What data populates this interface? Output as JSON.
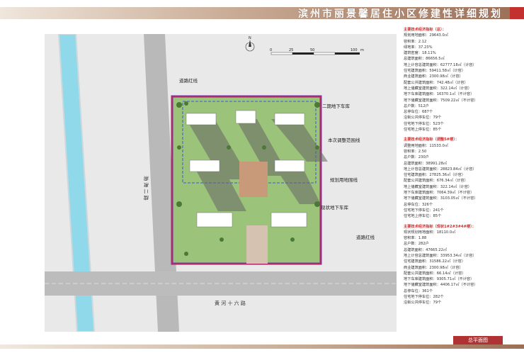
{
  "header": {
    "title": "滨州市丽景馨居住小区修建性详细规划"
  },
  "plan": {
    "road_vertical": "渤 海 二 路",
    "road_horizontal": "黄 河 十 六 路",
    "callouts": {
      "road_redline_top": "道路红线",
      "phase2_garage": "二期地下车库",
      "adjust_scope": "本次调整范围线",
      "planning_land": "规划用地围线",
      "existing_garage": "现状地下车库",
      "road_redline_bottom": "道路红线"
    },
    "scale": {
      "ticks": [
        "0",
        "25",
        "50",
        "100"
      ],
      "unit": "m"
    },
    "north_label": "N"
  },
  "panel": {
    "section1": {
      "title": "主要技术经济指标（总）：",
      "rows": [
        "规划用地面积：29643.0㎡",
        "容积率：2.12",
        "绿地率：37.23%",
        "建筑密度：18.11%",
        "总建筑面积：86656.5㎡",
        "地上计容总建筑面积：62777.18㎡（计容）",
        "住宅建筑面积：59411.58㎡（计容）",
        "商业建筑面积：2300.98㎡（计容）",
        "配套公共建筑面积：742.48㎡（计容）",
        "地上储藏室建筑面积：322.14㎡（计容）",
        "地下车库建筑面积：16370.1㎡（不计容）",
        "地下储藏室建筑面积：7509.22㎡（不计容）",
        "总户数：512户",
        "总停车位：687个",
        "沿街公共停车位：79个",
        "住宅地下停车位：523个",
        "住宅地上停车位：85个"
      ]
    },
    "section2": {
      "title": "主要技术经济指标（调整5#楼）：",
      "rows": [
        "调整用地面积：11533.0㎡",
        "容积率：2.50",
        "总户数：230户",
        "总建筑面积：38991.28㎡",
        "地上计容总建筑面积：28823.84㎡（计容）",
        "住宅建筑面积：27825.36㎡（计容）",
        "配套公共建筑面积：676.34㎡（计容）",
        "地上储藏室建筑面积：322.14㎡（计容）",
        "地下车库建筑面积：7064.39㎡（不计容）",
        "地下储藏室建筑面积：3103.05㎡（不计容）",
        "总停车位：326个",
        "住宅地下停车位：241个",
        "住宅地上停车位：85个"
      ]
    },
    "section3": {
      "title": "主要技术经济指标（现状1#2#3#4#楼）：",
      "rows": [
        "现状规划用地面积：18110.0㎡",
        "容积率：1.88",
        "总户数：282户",
        "总建筑面积：47665.22㎡",
        "地上计容总建筑面积：33953.34㎡（计容）",
        "住宅建筑面积：31586.22㎡（计容）",
        "商业建筑面积：2300.98㎡（计容）",
        "配套公共建筑面积：66.14㎡（计容）",
        "地下车库建筑面积：9305.71㎡（不计容）",
        "地下储藏室建筑面积：4406.17㎡（不计容）",
        "总停车位：361个",
        "住宅地下停车位：282个",
        "沿街公共停车位：79个"
      ]
    }
  },
  "footer": {
    "label": "总平面图"
  },
  "colors": {
    "accent": "#c23030",
    "redline": "#e0262d",
    "boundary": "#7b2fa8",
    "canal": "#7fd3e6"
  }
}
